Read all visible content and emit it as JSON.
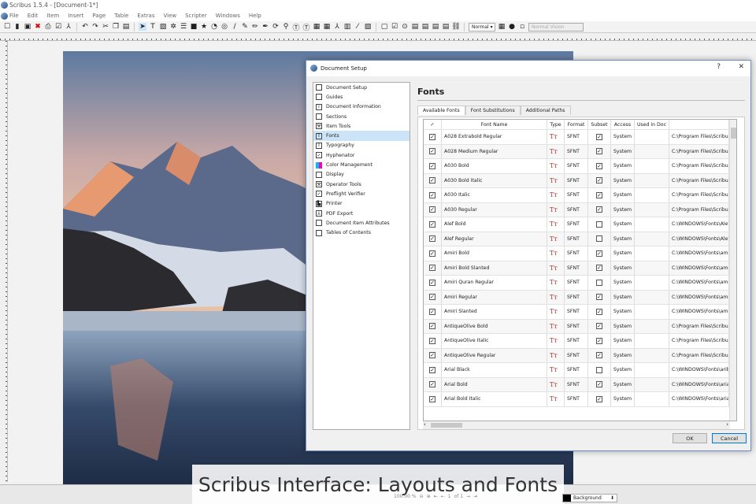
{
  "app": {
    "title": "Scribus 1.5.4 - [Document-1*]"
  },
  "menu": [
    "File",
    "Edit",
    "Item",
    "Insert",
    "Page",
    "Table",
    "Extras",
    "View",
    "Scripter",
    "Windows",
    "Help"
  ],
  "toolbar": {
    "mode_select": "Normal",
    "vision_select": "Normal Vision"
  },
  "statusbar": {
    "zoom": "100.00 %",
    "page": "1",
    "page_of": "of 1",
    "layer": "Background"
  },
  "caption": "Scribus Interface: Layouts and Fonts",
  "dialog": {
    "title": "Document Setup",
    "help": "?",
    "close": "✕",
    "nav": [
      {
        "label": "Document Setup",
        "icon": "document-setup-icon"
      },
      {
        "label": "Guides",
        "icon": "guides-icon"
      },
      {
        "label": "Document Information",
        "icon": "info-icon"
      },
      {
        "label": "Sections",
        "icon": "sections-icon"
      },
      {
        "label": "Item Tools",
        "icon": "wrench-icon"
      },
      {
        "label": "Fonts",
        "icon": "font-icon",
        "active": true
      },
      {
        "label": "Typography",
        "icon": "typography-icon"
      },
      {
        "label": "Hyphenator",
        "icon": "checkbox-icon"
      },
      {
        "label": "Color Management",
        "icon": "color-management-icon"
      },
      {
        "label": "Display",
        "icon": "display-icon"
      },
      {
        "label": "Operator Tools",
        "icon": "wrench-icon"
      },
      {
        "label": "Preflight Verifier",
        "icon": "checkbox-icon"
      },
      {
        "label": "Printer",
        "icon": "printer-icon"
      },
      {
        "label": "PDF Export",
        "icon": "pdf-icon"
      },
      {
        "label": "Document Item Attributes",
        "icon": "attributes-icon"
      },
      {
        "label": "Tables of Contents",
        "icon": "toc-icon"
      }
    ],
    "heading": "Fonts",
    "tabs": [
      "Available Fonts",
      "Font Substitutions",
      "Additional Paths"
    ],
    "columns": [
      "✓",
      "Font Name",
      "Type",
      "Format",
      "Subset",
      "Access",
      "Used in Doc",
      ""
    ],
    "rows": [
      {
        "name": "A028 Extrabold Regular",
        "format": "SFNT",
        "subset": true,
        "access": "System",
        "path": "C:\\Program Files\\Scribus"
      },
      {
        "name": "A028 Medium Regular",
        "format": "SFNT",
        "subset": true,
        "access": "System",
        "path": "C:\\Program Files\\Scribus"
      },
      {
        "name": "A030 Bold",
        "format": "SFNT",
        "subset": true,
        "access": "System",
        "path": "C:\\Program Files\\Scribus"
      },
      {
        "name": "A030 Bold Italic",
        "format": "SFNT",
        "subset": true,
        "access": "System",
        "path": "C:\\Program Files\\Scribus"
      },
      {
        "name": "A030 Italic",
        "format": "SFNT",
        "subset": true,
        "access": "System",
        "path": "C:\\Program Files\\Scribus"
      },
      {
        "name": "A030 Regular",
        "format": "SFNT",
        "subset": true,
        "access": "System",
        "path": "C:\\Program Files\\Scribus"
      },
      {
        "name": "Alef Bold",
        "format": "SFNT",
        "subset": false,
        "access": "System",
        "path": "C:\\WINDOWS\\Fonts\\Alef"
      },
      {
        "name": "Alef Regular",
        "format": "SFNT",
        "subset": false,
        "access": "System",
        "path": "C:\\WINDOWS\\Fonts\\Alef"
      },
      {
        "name": "Amiri Bold",
        "format": "SFNT",
        "subset": true,
        "access": "System",
        "path": "C:\\WINDOWS\\Fonts\\ami"
      },
      {
        "name": "Amiri Bold Slanted",
        "format": "SFNT",
        "subset": true,
        "access": "System",
        "path": "C:\\WINDOWS\\Fonts\\ami"
      },
      {
        "name": "Amiri Quran Regular",
        "format": "SFNT",
        "subset": false,
        "access": "System",
        "path": "C:\\WINDOWS\\Fonts\\ami"
      },
      {
        "name": "Amiri Regular",
        "format": "SFNT",
        "subset": true,
        "access": "System",
        "path": "C:\\WINDOWS\\Fonts\\ami"
      },
      {
        "name": "Amiri Slanted",
        "format": "SFNT",
        "subset": true,
        "access": "System",
        "path": "C:\\WINDOWS\\Fonts\\ami"
      },
      {
        "name": "AntiqueOlive Bold",
        "format": "SFNT",
        "subset": true,
        "access": "System",
        "path": "C:\\Program Files\\Scribus"
      },
      {
        "name": "AntiqueOlive Italic",
        "format": "SFNT",
        "subset": true,
        "access": "System",
        "path": "C:\\Program Files\\Scribus"
      },
      {
        "name": "AntiqueOlive Regular",
        "format": "SFNT",
        "subset": true,
        "access": "System",
        "path": "C:\\Program Files\\Scribus"
      },
      {
        "name": "Arial Black",
        "format": "SFNT",
        "subset": false,
        "access": "System",
        "path": "C:\\WINDOWS\\Fonts\\arib"
      },
      {
        "name": "Arial Bold",
        "format": "SFNT",
        "subset": true,
        "access": "System",
        "path": "C:\\WINDOWS\\Fonts\\aria"
      },
      {
        "name": "Arial Bold Italic",
        "format": "SFNT",
        "subset": true,
        "access": "System",
        "path": "C:\\WINDOWS\\Fonts\\aria"
      }
    ],
    "ok": "OK",
    "cancel": "Cancel"
  }
}
